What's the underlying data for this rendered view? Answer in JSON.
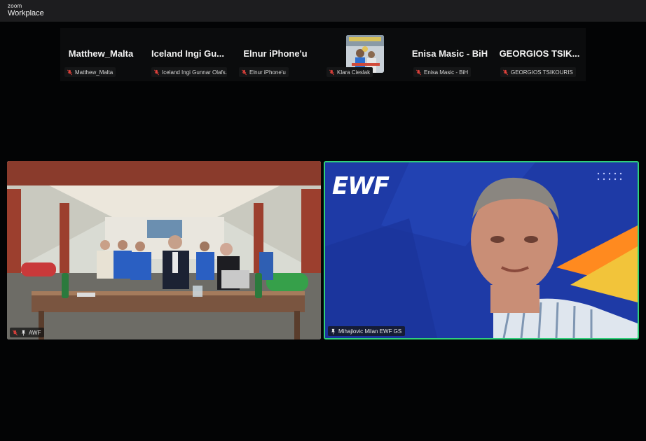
{
  "app": {
    "brand_small": "zoom",
    "brand_big": "Workplace"
  },
  "participants": [
    {
      "display": "Matthew_Malta",
      "label": "Matthew_Malta"
    },
    {
      "display": "Iceland Ingi Gu...",
      "label": "Iceland Ingi Gunnar Olafs..."
    },
    {
      "display": "Elnur iPhone'u",
      "label": "Elnur iPhone'u"
    },
    {
      "display": "",
      "label": "Klara Cieslak"
    },
    {
      "display": "Enisa Masic - BiH",
      "label": "Enisa Masic - BiH"
    },
    {
      "display": "GEORGIOS TSIK...",
      "label": "GEORGIOS TSIKOURIS"
    }
  ],
  "videos": {
    "left": {
      "label": "AWF"
    },
    "right": {
      "label": "Mihajlovic Milan EWF GS",
      "logo": "EWF"
    }
  },
  "colors": {
    "active_speaker_border": "#2fcf7a",
    "muted_mic": "#e0413b",
    "ewf_blue": "#1f3fb0"
  },
  "icons": {
    "muted": "mic-off-icon",
    "pinned": "pin-icon"
  }
}
